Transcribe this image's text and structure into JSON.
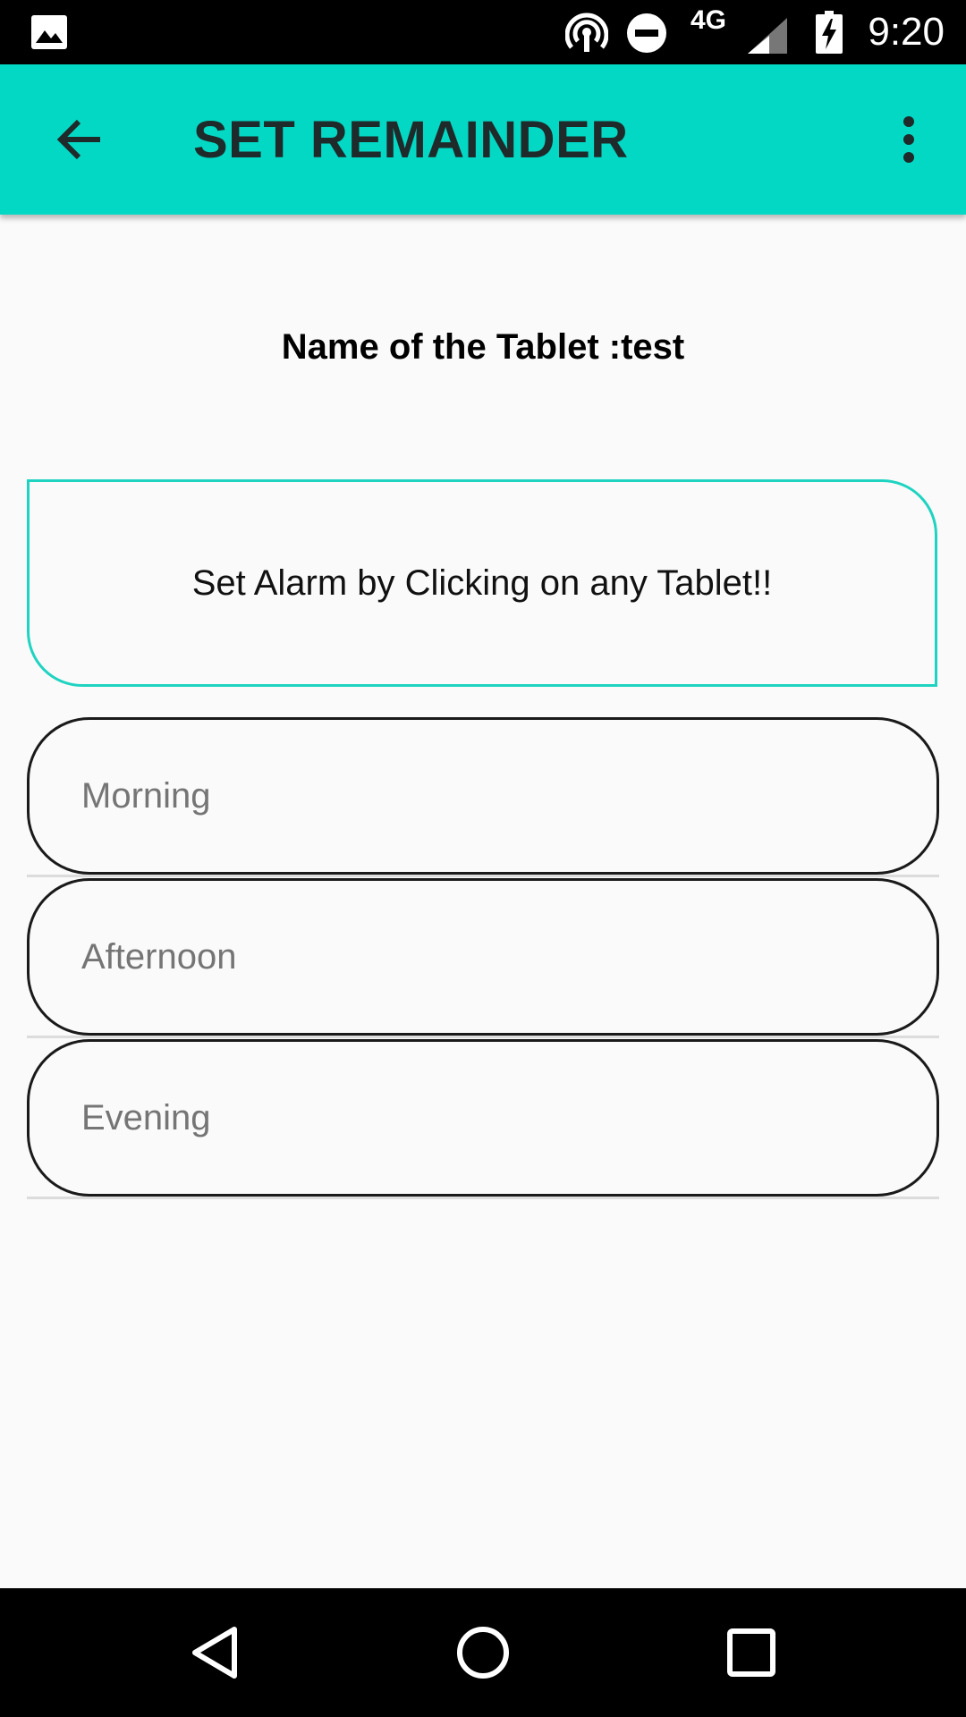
{
  "status_bar": {
    "time": "9:20",
    "network": "4G",
    "icons": [
      "image-icon",
      "hotspot-icon",
      "do-not-disturb-icon",
      "signal-icon",
      "battery-charging-icon"
    ]
  },
  "app_bar": {
    "title": "SET REMAINDER",
    "back_icon": "arrow-back-icon",
    "menu_icon": "more-vert-icon",
    "color": "#03d8c4"
  },
  "content": {
    "tablet_name": "Name of the Tablet :test",
    "hint": "Set Alarm by Clicking on any Tablet!!",
    "hint_border_color": "#1fd3c1",
    "slots": [
      {
        "label": "Morning"
      },
      {
        "label": "Afternoon"
      },
      {
        "label": "Evening"
      }
    ]
  },
  "nav_bar": {
    "icons": [
      "nav-back-icon",
      "nav-home-icon",
      "nav-recents-icon"
    ]
  }
}
